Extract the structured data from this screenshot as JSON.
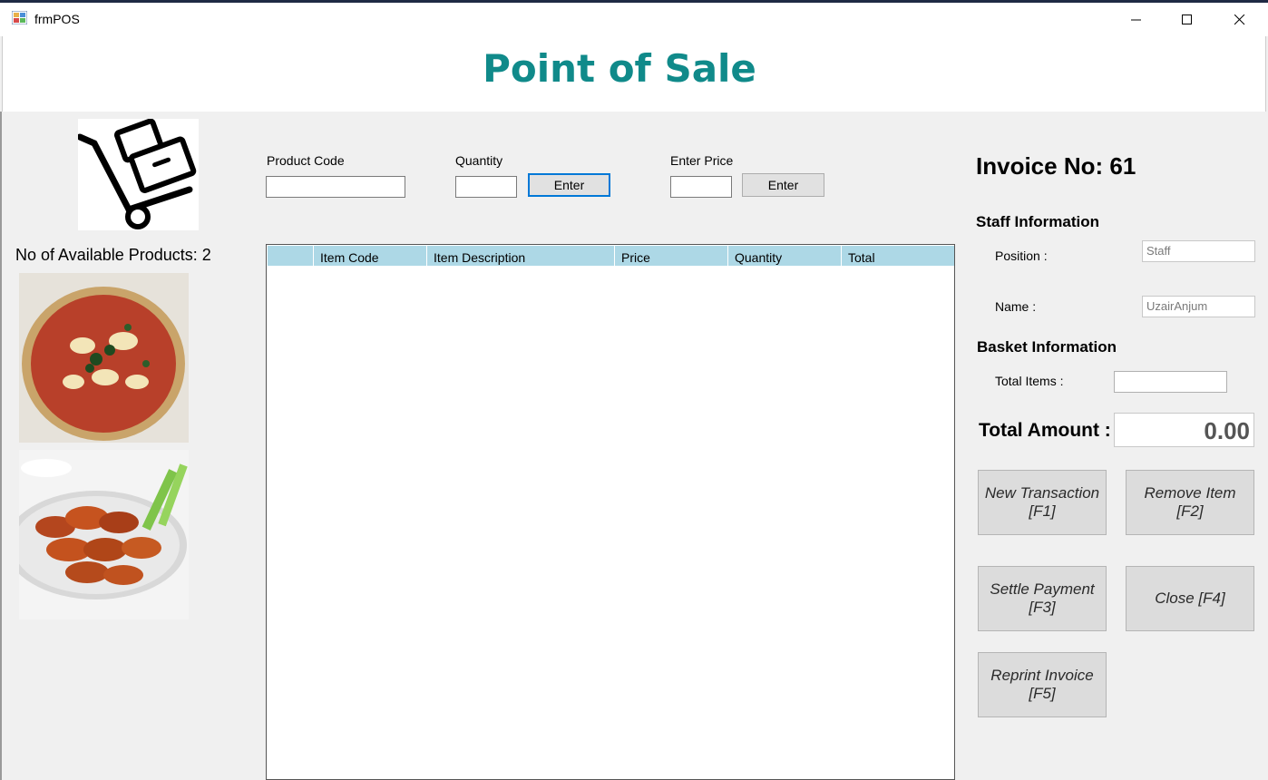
{
  "window": {
    "title": "frmPOS"
  },
  "header": {
    "title": "Point of Sale"
  },
  "left": {
    "available_label": "No of Available Products: 2",
    "products": [
      {
        "icon": "pizza-image"
      },
      {
        "icon": "chicken-wings-image"
      }
    ]
  },
  "inputs": {
    "product_code_label": "Product Code",
    "product_code_value": "",
    "quantity_label": "Quantity",
    "quantity_value": "",
    "quantity_enter": "Enter",
    "price_label": "Enter Price",
    "price_value": "",
    "price_enter": "Enter"
  },
  "grid": {
    "columns": [
      "Item Code",
      "Item Description",
      "Price",
      "Quantity",
      "Total"
    ],
    "rows": []
  },
  "invoice": {
    "label": "Invoice No: 61"
  },
  "staff": {
    "heading": "Staff Information",
    "position_label": "Position :",
    "position_value": "Staff",
    "name_label": "Name :",
    "name_value": "UzairAnjum"
  },
  "basket": {
    "heading": "Basket Information",
    "total_items_label": "Total Items :",
    "total_items_value": "",
    "total_amount_label": "Total Amount :",
    "total_amount_value": "0.00"
  },
  "actions": {
    "new_transaction": "New Transaction [F1]",
    "remove_item": "Remove Item [F2]",
    "settle_payment": "Settle Payment [F3]",
    "close": "Close [F4]",
    "reprint_invoice": "Reprint Invoice [F5]"
  },
  "colors": {
    "title": "#108a8a",
    "grid_header": "#add8e6",
    "focus": "#0078d7"
  }
}
